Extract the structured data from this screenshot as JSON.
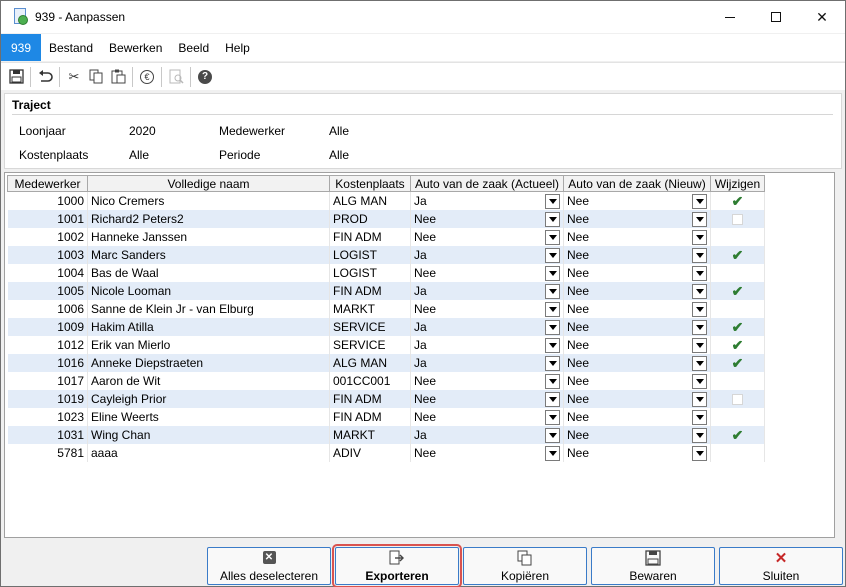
{
  "window": {
    "title": "939 - Aanpassen",
    "icon": "app-document-icon"
  },
  "menubar": {
    "first": "939",
    "items": [
      {
        "label": "Bestand"
      },
      {
        "label": "Bewerken"
      },
      {
        "label": "Beeld"
      },
      {
        "label": "Help"
      }
    ]
  },
  "toolbar": {
    "icons": [
      "save-icon",
      "undo-icon",
      "cut-icon",
      "copy-icon",
      "paste-icon",
      "euro-icon",
      "preview-icon",
      "help-icon"
    ]
  },
  "filter": {
    "title": "Traject",
    "fields": {
      "loonjaar_label": "Loonjaar",
      "loonjaar_value": "2020",
      "medewerker_label": "Medewerker",
      "medewerker_value": "Alle",
      "kostenplaats_label": "Kostenplaats",
      "kostenplaats_value": "Alle",
      "periode_label": "Periode",
      "periode_value": "Alle"
    }
  },
  "grid": {
    "columns": [
      "Medewerker",
      "Volledige naam",
      "Kostenplaats",
      "Auto van de zaak (Actueel)",
      "Auto van de zaak (Nieuw)",
      "Wijzigen"
    ],
    "rows": [
      {
        "id": "1000",
        "name": "Nico Cremers",
        "kp": "ALG MAN",
        "actueel": "Ja",
        "nieuw": "Nee",
        "wijzigen": "check"
      },
      {
        "id": "1001",
        "name": "Richard2 Peters2",
        "kp": "PROD",
        "actueel": "Nee",
        "nieuw": "Nee",
        "wijzigen": "box"
      },
      {
        "id": "1002",
        "name": "Hanneke Janssen",
        "kp": "FIN ADM",
        "actueel": "Nee",
        "nieuw": "Nee",
        "wijzigen": "none"
      },
      {
        "id": "1003",
        "name": "Marc Sanders",
        "kp": "LOGIST",
        "actueel": "Ja",
        "nieuw": "Nee",
        "wijzigen": "check"
      },
      {
        "id": "1004",
        "name": "Bas de Waal",
        "kp": "LOGIST",
        "actueel": "Nee",
        "nieuw": "Nee",
        "wijzigen": "none"
      },
      {
        "id": "1005",
        "name": "Nicole Looman",
        "kp": "FIN ADM",
        "actueel": "Ja",
        "nieuw": "Nee",
        "wijzigen": "check"
      },
      {
        "id": "1006",
        "name": "Sanne de Klein Jr - van Elburg",
        "kp": "MARKT",
        "actueel": "Nee",
        "nieuw": "Nee",
        "wijzigen": "none"
      },
      {
        "id": "1009",
        "name": "Hakim Atilla",
        "kp": "SERVICE",
        "actueel": "Ja",
        "nieuw": "Nee",
        "wijzigen": "check"
      },
      {
        "id": "1012",
        "name": "Erik van Mierlo",
        "kp": "SERVICE",
        "actueel": "Ja",
        "nieuw": "Nee",
        "wijzigen": "check"
      },
      {
        "id": "1016",
        "name": "Anneke Diepstraeten",
        "kp": "ALG MAN",
        "actueel": "Ja",
        "nieuw": "Nee",
        "wijzigen": "check"
      },
      {
        "id": "1017",
        "name": "Aaron de Wit",
        "kp": "001CC001",
        "actueel": "Nee",
        "nieuw": "Nee",
        "wijzigen": "none"
      },
      {
        "id": "1019",
        "name": "Cayleigh Prior",
        "kp": "FIN ADM",
        "actueel": "Nee",
        "nieuw": "Nee",
        "wijzigen": "box"
      },
      {
        "id": "1023",
        "name": "Eline Weerts",
        "kp": "FIN ADM",
        "actueel": "Nee",
        "nieuw": "Nee",
        "wijzigen": "none"
      },
      {
        "id": "1031",
        "name": "Wing Chan",
        "kp": "MARKT",
        "actueel": "Ja",
        "nieuw": "Nee",
        "wijzigen": "check"
      },
      {
        "id": "5781",
        "name": "aaaa",
        "kp": "ADIV",
        "actueel": "Nee",
        "nieuw": "Nee",
        "wijzigen": "none"
      }
    ]
  },
  "buttons": {
    "deselect": {
      "label": "Alles deselecteren",
      "icon": "close-box-icon"
    },
    "export": {
      "label": "Exporteren",
      "icon": "export-icon"
    },
    "copy": {
      "label": "Kopiëren",
      "icon": "copy-icon"
    },
    "save": {
      "label": "Bewaren",
      "icon": "save-icon"
    },
    "close": {
      "label": "Sluiten",
      "icon": "close-icon"
    }
  },
  "colors": {
    "accent": "#1e88e5",
    "row_alt": "#e3ecf8",
    "check": "#2e7d32",
    "focus_outline": "#d9534f"
  }
}
